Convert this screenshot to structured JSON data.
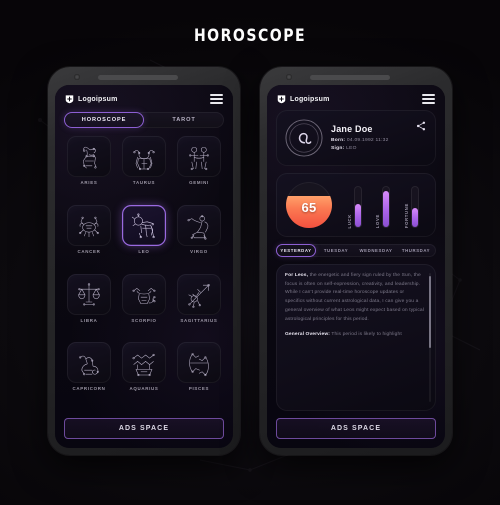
{
  "page": {
    "title": "HOROSCOPE"
  },
  "brand": {
    "name": "Logoipsum",
    "logo_icon": "shield-icon",
    "menu_icon": "hamburger-icon"
  },
  "colors": {
    "accent_purple": "#8d5fd3",
    "bar_purple": "#a963e8",
    "score_orange": "#fb7a52",
    "screen_bg": "#0a0810",
    "text_muted": "#8f8a9c"
  },
  "left_phone": {
    "tabs": [
      {
        "label": "HOROSCOPE",
        "active": true
      },
      {
        "label": "TAROT",
        "active": false
      }
    ],
    "signs": [
      {
        "label": "ARIES",
        "icon": "aries-constellation-icon",
        "selected": false
      },
      {
        "label": "TAURUS",
        "icon": "taurus-constellation-icon",
        "selected": false
      },
      {
        "label": "GEMINI",
        "icon": "gemini-constellation-icon",
        "selected": false
      },
      {
        "label": "CANCER",
        "icon": "cancer-constellation-icon",
        "selected": false
      },
      {
        "label": "LEO",
        "icon": "leo-constellation-icon",
        "selected": true
      },
      {
        "label": "VIRGO",
        "icon": "virgo-constellation-icon",
        "selected": false
      },
      {
        "label": "LIBRA",
        "icon": "libra-constellation-icon",
        "selected": false
      },
      {
        "label": "SCORPIO",
        "icon": "scorpio-constellation-icon",
        "selected": false
      },
      {
        "label": "SAGITTARIUS",
        "icon": "sagittarius-constellation-icon",
        "selected": false
      },
      {
        "label": "CAPRICORN",
        "icon": "capricorn-constellation-icon",
        "selected": false
      },
      {
        "label": "AQUARIUS",
        "icon": "aquarius-constellation-icon",
        "selected": false
      },
      {
        "label": "PISCES",
        "icon": "pisces-constellation-icon",
        "selected": false
      }
    ],
    "ads_label": "ADS SPACE"
  },
  "right_phone": {
    "profile": {
      "avatar_icon": "leo-zodiac-symbol-icon",
      "name": "Jane Doe",
      "born_label": "Born:",
      "born_value": "04.09.1992 11:32",
      "sign_label": "Sign:",
      "sign_value": "LEO",
      "share_icon": "share-icon"
    },
    "score": {
      "value": "65",
      "fill_percent": 70
    },
    "meters": [
      {
        "label": "LUCK",
        "percent": 55
      },
      {
        "label": "LOVE",
        "percent": 85
      },
      {
        "label": "FORTUNE",
        "percent": 45
      }
    ],
    "days": [
      {
        "label": "YESTERDAY",
        "active": true
      },
      {
        "label": "TUESDAY",
        "active": false
      },
      {
        "label": "WEDNESDAY",
        "active": false
      },
      {
        "label": "THURSDAY",
        "active": false
      }
    ],
    "reading": {
      "lead_bold": "For Leos,",
      "paragraph1": " the energetic and fiery sign ruled by the Sun, the focus is often on self-expression, creativity, and leadership. While I can't provide real-time horoscope updates or specifics without current astrological data, I can give you a general overview of what Leos might expect based on typical astrological principles for this period.",
      "section_bold": "General Overview:",
      "paragraph2": " This period is likely to highlight"
    },
    "ads_label": "ADS SPACE"
  }
}
